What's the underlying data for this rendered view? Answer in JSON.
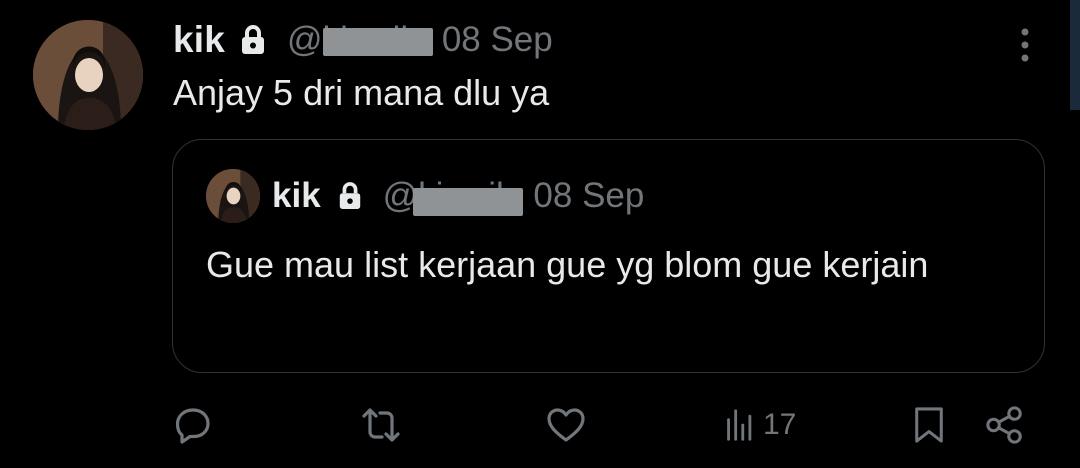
{
  "tweet": {
    "author_name": "kik",
    "handle": "@kiwoil",
    "separator": "·",
    "date": "08 Sep",
    "text": "Anjay 5 dri mana dlu ya",
    "avatar_icon": "profile-photo"
  },
  "quoted_tweet": {
    "author_name": "kik",
    "handle": "@kiwoil",
    "separator": "·",
    "date": "08 Sep",
    "text": "Gue mau list kerjaan gue yg blom gue kerjain"
  },
  "actions": {
    "reply_icon": "reply-icon",
    "retweet_icon": "retweet-icon",
    "like_icon": "heart-icon",
    "views_icon": "analytics-icon",
    "views_count": "17",
    "bookmark_icon": "bookmark-icon",
    "share_icon": "share-icon"
  },
  "colors": {
    "background": "#000000",
    "primary_text": "#e7e9ea",
    "secondary_text": "#71767b",
    "border": "#2f3336"
  }
}
